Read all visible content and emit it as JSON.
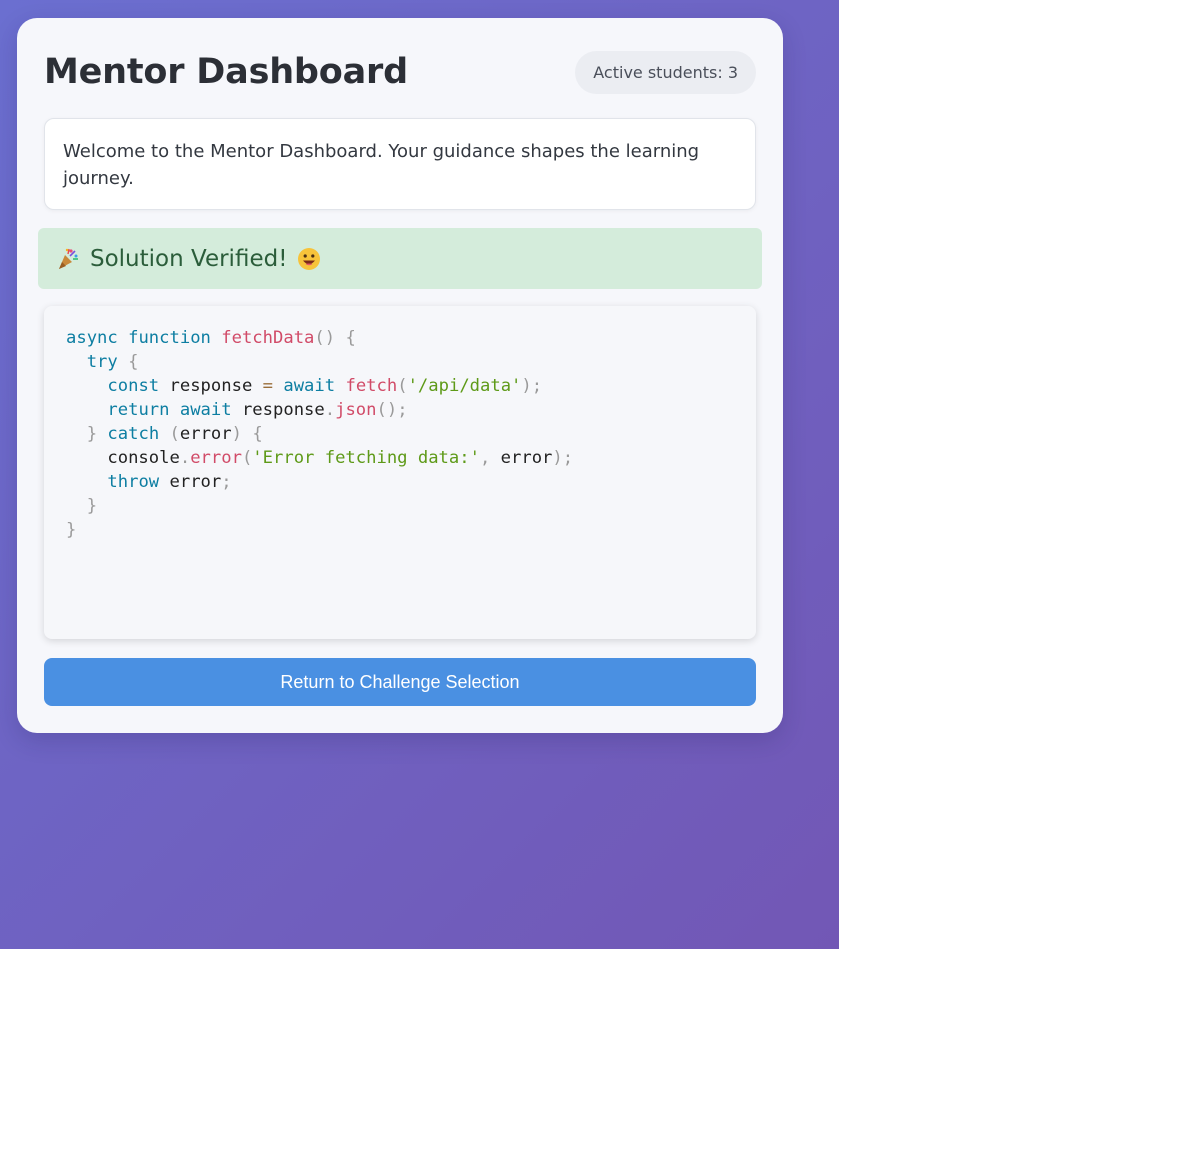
{
  "header": {
    "title": "Mentor Dashboard",
    "active_students": "Active students: 3"
  },
  "welcome": {
    "text": "Welcome to the Mentor Dashboard. Your guidance shapes the learning journey."
  },
  "success": {
    "message": "Solution Verified!",
    "leading_icon": "party-popper-icon",
    "trailing_icon": "grinning-face-icon"
  },
  "code": {
    "language": "javascript",
    "source": "async function fetchData() {\n  try {\n    const response = await fetch('/api/data');\n    return await response.json();\n  } catch (error) {\n    console.error('Error fetching data:', error);\n    throw error;\n  }\n}"
  },
  "actions": {
    "return_label": "Return to Challenge Selection"
  },
  "colors": {
    "accent": "#4a90e2",
    "success_bg": "#d4ecdb",
    "success_text": "#2b5d3a",
    "gradient_start": "#6b6fd0",
    "gradient_end": "#7257b5"
  }
}
